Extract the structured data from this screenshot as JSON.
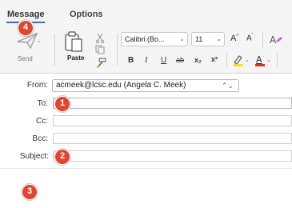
{
  "ribbon": {
    "tabs": [
      {
        "label": "Message",
        "active": true
      },
      {
        "label": "Options",
        "active": false
      }
    ],
    "send_label": "Send",
    "paste_label": "Paste",
    "font_name": "Calibri (Bo...",
    "font_size": "11",
    "format_buttons": {
      "bold": "B",
      "italic": "I",
      "underline": "U",
      "strikethrough": "ab",
      "subscript": "x₂",
      "superscript": "x²"
    }
  },
  "compose": {
    "from_label": "From:",
    "from_value": "acmeek@lcsc.edu (Angela C. Meek)",
    "to_label": "To:",
    "cc_label": "Cc:",
    "bcc_label": "Bcc:",
    "subject_label": "Subject:"
  },
  "badges": [
    "4",
    "1",
    "2",
    "3"
  ],
  "colors": {
    "badge": "#e2442f",
    "tab_underline": "#3b6fb6",
    "highlight": "#f5e11a",
    "font_color": "#d0312d"
  }
}
